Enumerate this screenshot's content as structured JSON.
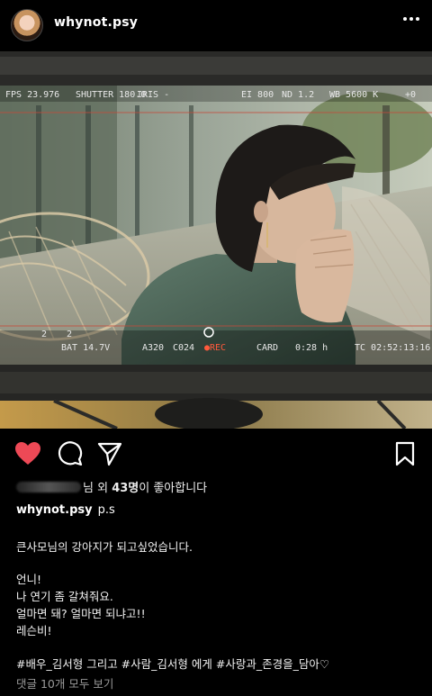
{
  "header": {
    "username": "whynot.psy",
    "more_icon": "more-horizontal-icon"
  },
  "viewfinder": {
    "fps": "FPS 23.976",
    "shutter": "SHUTTER 180.0",
    "iris": "IRIS -",
    "ei": "EI 800",
    "nd": "ND 1.2",
    "wb": "WB 5600 K",
    "tint": "+0",
    "scale_left": "2",
    "scale_mid": "2",
    "bat": "BAT 14.7V",
    "media": "A320",
    "clip": "C024",
    "rec": "●REC",
    "card": "CARD",
    "remaining": "0:28 h",
    "tc": "TC 02:52:13:16"
  },
  "actions": {
    "like_icon": "heart-icon",
    "comment_icon": "comment-icon",
    "share_icon": "send-icon",
    "save_icon": "bookmark-icon",
    "like_color": "#ed4956"
  },
  "likes": {
    "suffix": "님 외 ",
    "count": "43명",
    "tail": "이 좋아합니다"
  },
  "caption": {
    "username": "whynot.psy",
    "first": "p.s",
    "lines": [
      "큰사모님의 강아지가 되고싶었습니다.",
      "언니!",
      "나 연기 좀 갈쳐줘요.",
      "얼마면 돼? 얼마면 되냐고!!",
      "레슨비!",
      "#배우_김서형 그리고 #사람_김서형 에게 #사랑과_존경을_담아♡"
    ]
  },
  "comments": {
    "label": "댓글 10개 모두 보기"
  }
}
